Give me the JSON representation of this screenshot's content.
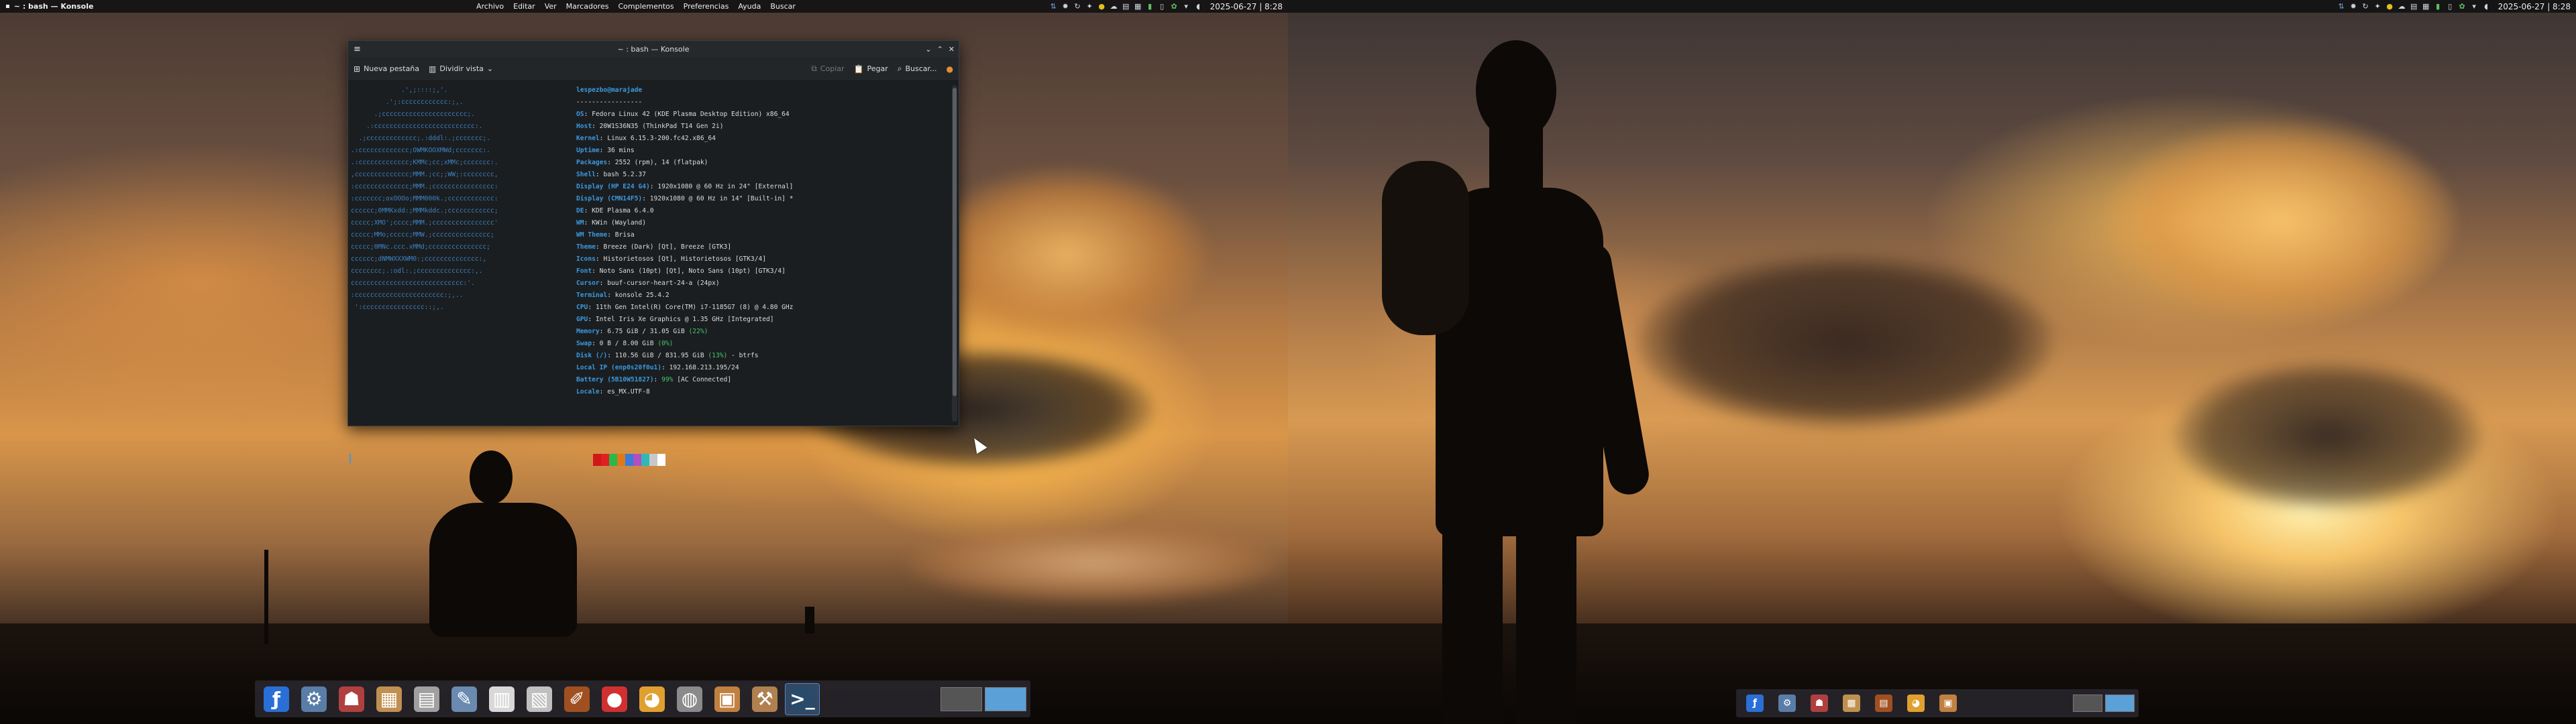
{
  "app_title": "~ : bash — Konsole",
  "menubar": [
    "Archivo",
    "Editar",
    "Ver",
    "Marcadores",
    "Complementos",
    "Preferencias",
    "Ayuda",
    "Buscar"
  ],
  "clock": "2025-06-27 | 8:28",
  "tray_icons": [
    "network-icon",
    "bug-icon",
    "refresh-icon",
    "wand-icon",
    "warning-icon",
    "cloud-icon",
    "document-icon",
    "calendar-icon",
    "battery-icon",
    "clipboard-icon",
    "plant-icon",
    "wifi-icon",
    "notification-icon"
  ],
  "konsole": {
    "window_title": "~ : bash — Konsole",
    "toolbar": {
      "new_tab": "Nueva pestaña",
      "split_view": "Dividir vista",
      "copy": "Copiar",
      "paste": "Pegar",
      "search": "Buscar..."
    },
    "logo_lines": [
      "             .',;::::;,'.",
      "         .';:cccccccccccc:;,.",
      "      .;cccccccccccccccccccccc;.",
      "    .:cccccccccccccccccccccccccc:.",
      "  .;ccccccccccccc;.:dddl:.;ccccccc;.",
      ".:ccccccccccccc;OWMKOOXMWd;ccccccc:.",
      ".:ccccccccccccc;KMMc;cc;xMMc;ccccccc:.",
      ",cccccccccccccc;MMM.;cc;;WW;:cccccccc,",
      ":cccccccccccccc;MMM.;cccccccccccccccc:",
      ":ccccccc;oxOOOo;MMM000k.;cccccccccccc:",
      "cccccc;0MMKxdd:;MMMkddc.;cccccccccccc;",
      "ccccc;XMO';cccc;MMM.;cccccccccccccccc'",
      "ccccc;MMo;ccccc;MMW.;ccccccccccccccc;",
      "ccccc;0MNc.ccc.xMMd;ccccccccccccccc;",
      "cccccc;dNMWXXXWM0:;cccccccccccccc:,",
      "cccccccc;.:odl:.;cccccccccccccc:,.",
      "ccccccccccccccccccccccccccccc:'.",
      ":ccccccccccccccccccccccc:;,..",
      " ':cccccccccccccccc::;,."
    ],
    "info": [
      {
        "k": "lespezbo@marajade",
        "v": ""
      },
      {
        "k": "",
        "v": "-----------------"
      },
      {
        "k": "OS",
        "v": ": Fedora Linux 42 (KDE Plasma Desktop Edition) x86_64"
      },
      {
        "k": "Host",
        "v": ": 20W1S36N35 (ThinkPad T14 Gen 2i)"
      },
      {
        "k": "Kernel",
        "v": ": Linux 6.15.3-200.fc42.x86_64"
      },
      {
        "k": "Uptime",
        "v": ": 36 mins"
      },
      {
        "k": "Packages",
        "v": ": 2552 (rpm), 14 (flatpak)"
      },
      {
        "k": "Shell",
        "v": ": bash 5.2.37"
      },
      {
        "k": "Display (HP E24 G4)",
        "v": ": 1920x1080 @ 60 Hz in 24\" [External]"
      },
      {
        "k": "Display (CMN14F5)",
        "v": ": 1920x1080 @ 60 Hz in 14\" [Built-in] *"
      },
      {
        "k": "DE",
        "v": ": KDE Plasma 6.4.0"
      },
      {
        "k": "WM",
        "v": ": KWin (Wayland)"
      },
      {
        "k": "WM Theme",
        "v": ": Brisa"
      },
      {
        "k": "Theme",
        "v": ": Breeze (Dark) [Qt], Breeze [GTK3]"
      },
      {
        "k": "Icons",
        "v": ": Historietosos [Qt], Historietosos [GTK3/4]"
      },
      {
        "k": "Font",
        "v": ": Noto Sans (10pt) [Qt], Noto Sans (10pt) [GTK3/4]"
      },
      {
        "k": "Cursor",
        "v": ": buuf-cursor-heart-24-a (24px)"
      },
      {
        "k": "Terminal",
        "v": ": konsole 25.4.2"
      },
      {
        "k": "CPU",
        "v": ": 11th Gen Intel(R) Core(TM) i7-1185G7 (8) @ 4.80 GHz"
      },
      {
        "k": "GPU",
        "v": ": Intel Iris Xe Graphics @ 1.35 GHz [Integrated]"
      },
      {
        "k": "Memory",
        "v": ": 6.75 GiB / 31.05 GiB ",
        "g": "(22%)"
      },
      {
        "k": "Swap",
        "v": ": 0 B / 8.00 GiB ",
        "g": "(0%)"
      },
      {
        "k": "Disk (/)",
        "v": ": 110.56 GiB / 831.95 GiB ",
        "g": "(13%)",
        "t": " - btrfs"
      },
      {
        "k": "Local IP (enp0s20f0u1)",
        "v": ": 192.168.213.195/24"
      },
      {
        "k": "Battery (5B10W51827)",
        "v": ": ",
        "g": "99%",
        "t": " [AC Connected]"
      },
      {
        "k": "Locale",
        "v": ": es_MX.UTF-8"
      }
    ],
    "swatch_colors": [
      "#d01818",
      "#e02020",
      "#2bb84a",
      "#e07818",
      "#3a7ad8",
      "#b050c0",
      "#30b8b8",
      "#c8c8c8",
      "#ffffff"
    ]
  },
  "dock_left": [
    {
      "name": "plasma-launcher-icon",
      "glyph": "ƒ",
      "color": "#2a6fd6"
    },
    {
      "name": "network-tool-icon",
      "glyph": "⚙",
      "color": "#5a7da8"
    },
    {
      "name": "terminal-cat-icon",
      "glyph": "☗",
      "color": "#b04040"
    },
    {
      "name": "files-icon",
      "glyph": "▦",
      "color": "#c09050"
    },
    {
      "name": "archive-icon",
      "glyph": "▤",
      "color": "#a0a0a0"
    },
    {
      "name": "text-editor-icon",
      "glyph": "✎",
      "color": "#6a8ab0"
    },
    {
      "name": "document-icon",
      "glyph": "▥",
      "color": "#d8d8d8"
    },
    {
      "name": "notes-icon",
      "glyph": "▧",
      "color": "#c0c0c0"
    },
    {
      "name": "pencil-icon",
      "glyph": "✐",
      "color": "#a05020"
    },
    {
      "name": "bug-app-icon",
      "glyph": "●",
      "color": "#d03030"
    },
    {
      "name": "color-wheel-icon",
      "glyph": "◕",
      "color": "#e0a030"
    },
    {
      "name": "jar-icon",
      "glyph": "◍",
      "color": "#8a8a8a"
    },
    {
      "name": "package-icon",
      "glyph": "▣",
      "color": "#c08040"
    },
    {
      "name": "tools-icon",
      "glyph": "⚒",
      "color": "#b08050"
    },
    {
      "name": "konsole-icon",
      "glyph": ">_",
      "color": "#2a4a6a",
      "active": true
    }
  ],
  "dock_right": [
    {
      "name": "plasma-launcher-icon",
      "glyph": "ƒ",
      "color": "#2a6fd6"
    },
    {
      "name": "network-tool-icon",
      "glyph": "⚙",
      "color": "#5a7da8"
    },
    {
      "name": "terminal-cat-icon",
      "glyph": "☗",
      "color": "#b04040"
    },
    {
      "name": "files-icon",
      "glyph": "▦",
      "color": "#c09050"
    },
    {
      "name": "archive-icon",
      "glyph": "▤",
      "color": "#a05020"
    },
    {
      "name": "color-wheel-icon",
      "glyph": "◕",
      "color": "#e0a030"
    },
    {
      "name": "package-icon",
      "glyph": "▣",
      "color": "#c08040"
    }
  ]
}
